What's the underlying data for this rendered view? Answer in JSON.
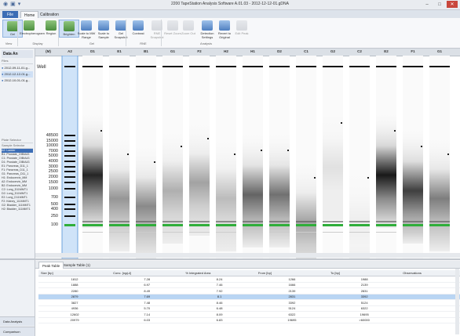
{
  "app": {
    "title": "2200 TapeStation Analysis Software A.01.03 - 2012-12-12-01.gDNA",
    "win_minimize": "–",
    "win_restore": "□",
    "win_close": "✕"
  },
  "tabs": {
    "file": "File",
    "home": "Home",
    "calibration": "Calibration"
  },
  "ribbon": {
    "buttons": [
      {
        "label": "Gel",
        "icon": "gel-view-icon",
        "selected": true
      },
      {
        "label": "Electropherogram",
        "icon": "electropherogram-icon",
        "selected": false
      },
      {
        "label": "Region",
        "icon": "region-icon",
        "selected": false
      },
      {
        "label": "Brighten",
        "icon": "brighten-icon",
        "selected": true
      },
      {
        "label": "Scale to MW Range",
        "icon": "scale-mw-icon",
        "selected": false
      },
      {
        "label": "Scale to Sample",
        "icon": "scale-sample-icon",
        "selected": false
      },
      {
        "label": "Gel Snapshot",
        "icon": "gel-snapshot-icon",
        "selected": false
      },
      {
        "label": "Contrast",
        "icon": "contrast-icon",
        "selected": false
      },
      {
        "label": "RNE Snapshot",
        "icon": "rne-snapshot-icon",
        "selected": false
      },
      {
        "label": "Reset Zoom",
        "icon": "reset-zoom-icon",
        "selected": false
      },
      {
        "label": "Zoom Out",
        "icon": "zoom-out-icon",
        "selected": false
      },
      {
        "label": "Detection Settings",
        "icon": "detection-settings-icon",
        "selected": false
      },
      {
        "label": "Revert to Original",
        "icon": "revert-icon",
        "selected": false
      },
      {
        "label": "Edit Peak",
        "icon": "edit-peak-icon",
        "selected": false
      }
    ],
    "groups": [
      "View",
      "Display",
      "Gel",
      "RNE",
      "Analysis"
    ]
  },
  "left_panel": {
    "header": "Data An",
    "files_label": "Files",
    "files": [
      "2012-09-11-01.g...",
      "2012-12-12-01.g...",
      "2012-10-01-01.g..."
    ],
    "plate_selector": "Plate Selector",
    "sample_selector": "Sample Selector",
    "samples": [
      "A2: Ladder",
      "B1: Prostate_OIB/A43",
      "C1: Prostate_OIB/A43",
      "D1: Prostate_OIB/A43",
      "E1: Pancreas_D11_1",
      "F1: Pancreas_D11_1",
      "G1: Pancreas_D11_1",
      "H1: Endocervix_MM",
      "A2: Endocervix_MM",
      "B2: Endocervix_MM",
      "C2: Lung_D11MMT1",
      "D2: Lung_D11MMT1",
      "E2: Lung_D11MMT1",
      "F2: Kidney_111MMT1",
      "G2: Bladder_111MMT1",
      "H2: Bladder_111MMT1"
    ],
    "bottom1": "Data Analysis",
    "bottom2": "Comparison"
  },
  "gel": {
    "lanes": [
      "(M)",
      "A2",
      "D1",
      "E1",
      "B1",
      "G1",
      "F2",
      "H2",
      "H1",
      "D2",
      "C1",
      "G2",
      "C2",
      "E2",
      "F1",
      "G1"
    ],
    "well_label": "Well",
    "ladder_labels": [
      "48500",
      "15000",
      "10000",
      "7000",
      "5000",
      "4000",
      "3000",
      "2500",
      "2000",
      "1500",
      "1000",
      "700",
      "500",
      "400",
      "250",
      "100"
    ]
  },
  "table": {
    "tabs": [
      "Peak Table",
      "Sample Table (1)"
    ],
    "columns": [
      "Size [bp]",
      "Conc. [ng/µl]",
      "% Integrated Area",
      "From [bp]",
      "To [bp]",
      "Observations"
    ],
    "rows": [
      [
        "1812",
        "7.28",
        "8.24",
        "1266",
        "1988",
        ""
      ],
      [
        "1888",
        "6.97",
        "7.46",
        "1666",
        "2139",
        ""
      ],
      [
        "2280",
        "8.49",
        "7.92",
        "2139",
        "2831",
        ""
      ],
      [
        "2879",
        "7.69",
        "8.1",
        "2831",
        "3392",
        ""
      ],
      [
        "3827",
        "7.48",
        "8.46",
        "3392",
        "5124",
        ""
      ],
      [
        "4936",
        "5.70",
        "6.48",
        "5124",
        "6322",
        ""
      ],
      [
        "12602",
        "7.14",
        "8.09",
        "6322",
        "19695",
        ""
      ],
      [
        "20979",
        "6.03",
        "6.83",
        "19695",
        ">60000",
        ""
      ]
    ],
    "selected_row": 3
  },
  "colors": {
    "accent": "#3b6db5",
    "marker_green": "#2fae3a",
    "selection": "#b9d5f3"
  }
}
